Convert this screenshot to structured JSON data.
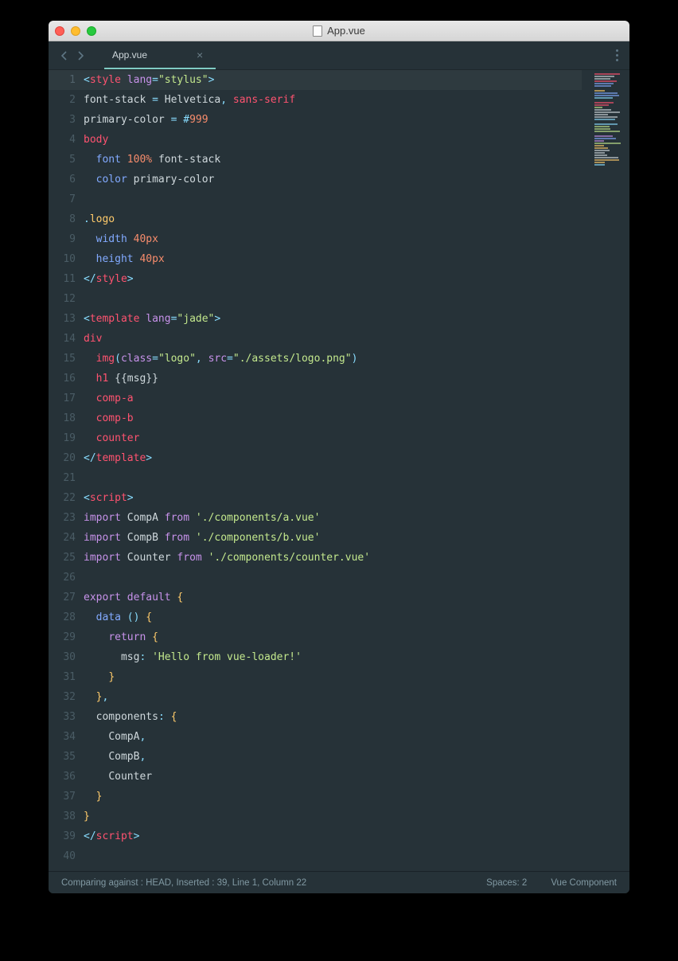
{
  "window": {
    "title": "App.vue"
  },
  "tabs": {
    "active": "App.vue"
  },
  "status": {
    "left": "Comparing against : HEAD, Inserted : 39, Line 1, Column 22",
    "spaces": "Spaces: 2",
    "lang": "Vue Component"
  },
  "line_count": 40,
  "tokens": {
    "r1": [
      "<",
      "style",
      " ",
      "lang",
      "=",
      "\"stylus\"",
      ">"
    ],
    "r2": [
      "font-stack",
      " ",
      "=",
      " ",
      "Helvetica",
      ",",
      " ",
      "sans-serif"
    ],
    "r3": [
      "primary-color",
      " ",
      "=",
      " ",
      "#",
      "999"
    ],
    "r4": [
      "body"
    ],
    "r5": [
      "  ",
      "font",
      " ",
      "100%",
      " ",
      "font-stack"
    ],
    "r6": [
      "  ",
      "color",
      " ",
      "primary-color"
    ],
    "r8": [
      ".",
      "logo"
    ],
    "r9": [
      "  ",
      "width",
      " ",
      "40px"
    ],
    "r10": [
      "  ",
      "height",
      " ",
      "40px"
    ],
    "r11": [
      "</",
      "style",
      ">"
    ],
    "r13": [
      "<",
      "template",
      " ",
      "lang",
      "=",
      "\"jade\"",
      ">"
    ],
    "r14": [
      "div"
    ],
    "r15": [
      "  ",
      "img",
      "(",
      "class",
      "=",
      "\"logo\"",
      ",",
      " ",
      "src",
      "=",
      "\"./assets/logo.png\"",
      ")"
    ],
    "r16": [
      "  ",
      "h1",
      " ",
      "{{msg}}"
    ],
    "r17": [
      "  ",
      "comp-a"
    ],
    "r18": [
      "  ",
      "comp-b"
    ],
    "r19": [
      "  ",
      "counter"
    ],
    "r20": [
      "</",
      "template",
      ">"
    ],
    "r22": [
      "<",
      "script",
      ">"
    ],
    "r23": [
      "import",
      " ",
      "CompA",
      " ",
      "from",
      " ",
      "'./components/a.vue'"
    ],
    "r24": [
      "import",
      " ",
      "CompB",
      " ",
      "from",
      " ",
      "'./components/b.vue'"
    ],
    "r25": [
      "import",
      " ",
      "Counter",
      " ",
      "from",
      " ",
      "'./components/counter.vue'"
    ],
    "r27": [
      "export",
      " ",
      "default",
      " ",
      "{"
    ],
    "r28": [
      "  ",
      "data",
      " ",
      "()",
      " ",
      "{"
    ],
    "r29": [
      "    ",
      "return",
      " ",
      "{"
    ],
    "r30": [
      "      ",
      "msg",
      ":",
      " ",
      "'Hello from vue-loader!'"
    ],
    "r31": [
      "    ",
      "}"
    ],
    "r32": [
      "  ",
      "}",
      ","
    ],
    "r33": [
      "  ",
      "components",
      ":",
      " ",
      "{"
    ],
    "r34": [
      "    ",
      "CompA",
      ","
    ],
    "r35": [
      "    ",
      "CompB",
      ","
    ],
    "r36": [
      "    ",
      "Counter"
    ],
    "r37": [
      "  ",
      "}"
    ],
    "r38": [
      "}"
    ],
    "r39": [
      "</",
      "script",
      ">"
    ]
  }
}
